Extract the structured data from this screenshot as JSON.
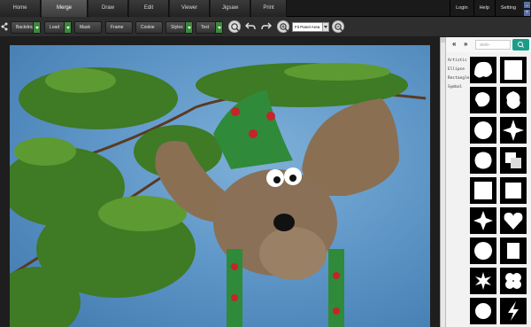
{
  "tabs": [
    {
      "label": "Home"
    },
    {
      "label": "Merge"
    },
    {
      "label": "Draw"
    },
    {
      "label": "Edit"
    },
    {
      "label": "Viewer"
    },
    {
      "label": "Jigsaw"
    },
    {
      "label": "Print"
    }
  ],
  "top_links": {
    "login": "Login",
    "help": "Help",
    "setting": "Setting"
  },
  "toolbar": {
    "backdrop": "Backdrop",
    "load": "Load",
    "mask": "Mask",
    "frame": "Frame",
    "cookie": "Cookie",
    "styles": "Styles",
    "text": "Text",
    "zoom_select": "Fit Panel Area"
  },
  "panel": {
    "search_placeholder": "Shift+",
    "categories": [
      "Artistic",
      "Ellipse",
      "Rectangle",
      "Symbol"
    ]
  },
  "colors": {
    "accent_green": "#3a8a3a",
    "search_button": "#1a9e8a"
  }
}
